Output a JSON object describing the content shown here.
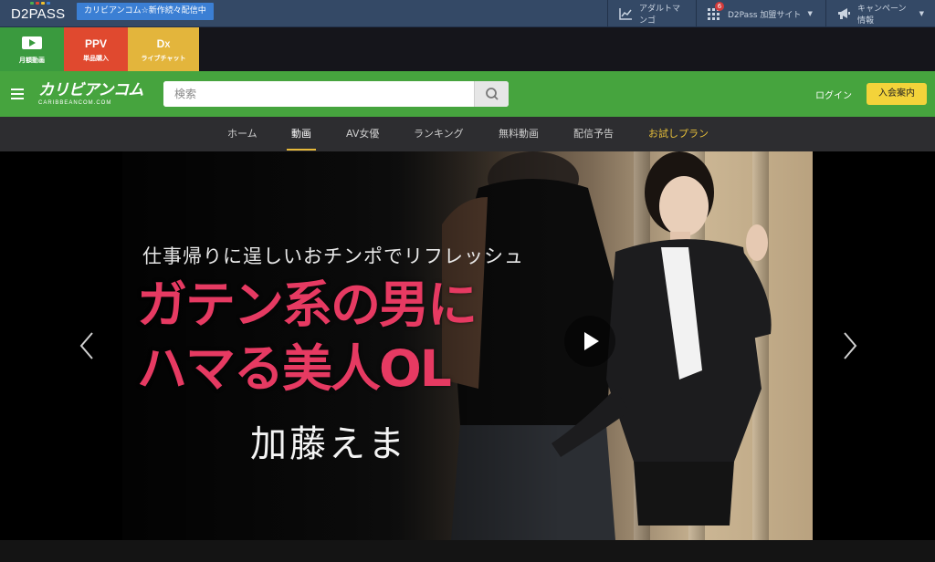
{
  "d2pass": {
    "logo": "D2PASS",
    "logo_dot_colors": [
      "#4caf50",
      "#e0492f",
      "#f0c030",
      "#3b7fd4"
    ],
    "news_badge": "カリビアンコム☆新作続々配信中",
    "items": [
      {
        "label": "アダルトマンゴ",
        "icon": "chart-icon"
      },
      {
        "label": "D2Pass 加盟サイト",
        "icon": "grid-icon",
        "badge": "6"
      },
      {
        "label": "キャンペーン情報",
        "icon": "megaphone-icon"
      }
    ]
  },
  "services": [
    {
      "title": "",
      "label": "月額動画",
      "icon": "play-icon",
      "color": "#3a9a3e"
    },
    {
      "title": "PPV",
      "label": "単品購入",
      "color": "#e0492f"
    },
    {
      "title": "DX",
      "label": "ライブチャット",
      "color": "#e3b53c"
    }
  ],
  "header": {
    "brand_name": "カリビアンコム",
    "brand_sub": "CARIBBEANCOM.COM",
    "search_placeholder": "検索",
    "login_label": "ログイン",
    "join_label": "入会案内",
    "accent_color": "#46a43e"
  },
  "nav": {
    "tabs": [
      "ホーム",
      "動画",
      "AV女優",
      "ランキング",
      "無料動画",
      "配信予告",
      "お試しプラン"
    ],
    "active_index": 1
  },
  "hero": {
    "tagline": "仕事帰りに逞しいおチンポでリフレッシュ",
    "headline_line1": "ガテン系の男に",
    "headline_line2": "ハマる美人OL",
    "actress": "加藤えま",
    "headline_color": "#e63a62"
  }
}
